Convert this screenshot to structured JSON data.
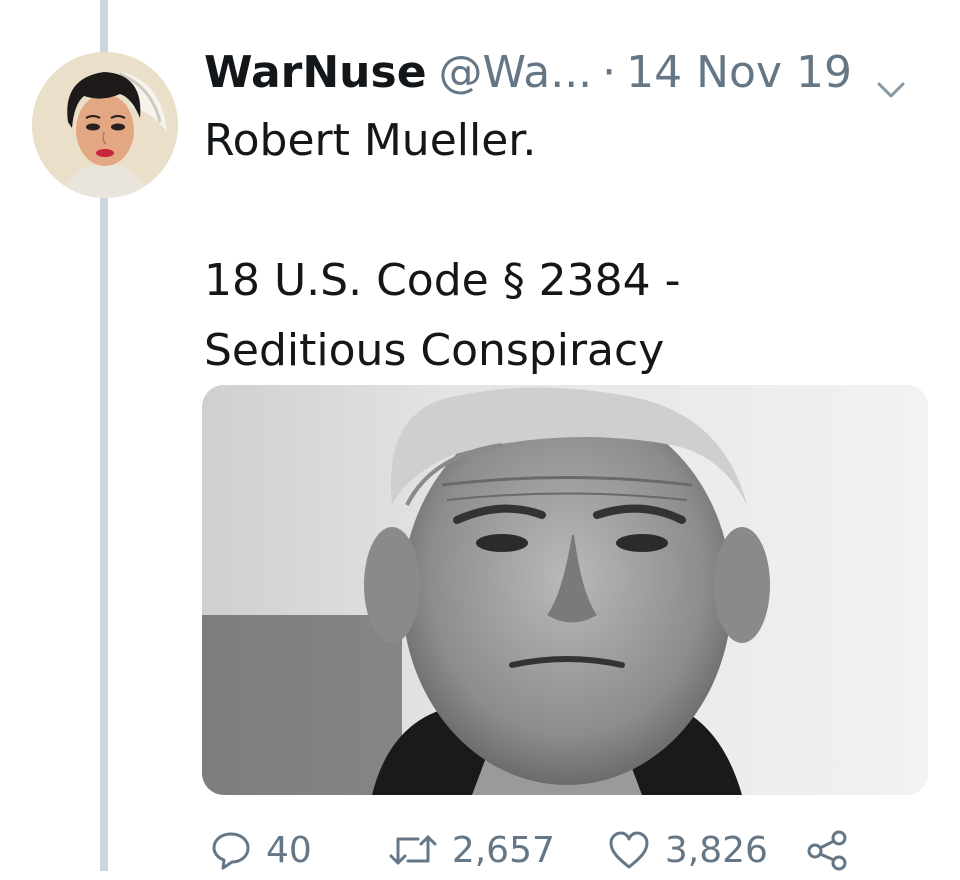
{
  "tweet": {
    "display_name": "WarNuse",
    "handle": "@Wa...",
    "separator": "·",
    "timestamp": "14 Nov 19",
    "text_line1": "Robert Mueller.",
    "text_line2": "18 U.S. Code § 2384 -",
    "text_line3": "Seditious Conspiracy"
  },
  "actions": {
    "replies": "40",
    "retweets": "2,657",
    "likes": "3,826"
  },
  "icons": {
    "reply": "reply-icon",
    "retweet": "retweet-icon",
    "like": "heart-icon",
    "share": "share-icon",
    "menu": "chevron-down-icon"
  },
  "colors": {
    "text": "#14171a",
    "secondary": "#657786",
    "thread_line": "#ccd6dd"
  }
}
